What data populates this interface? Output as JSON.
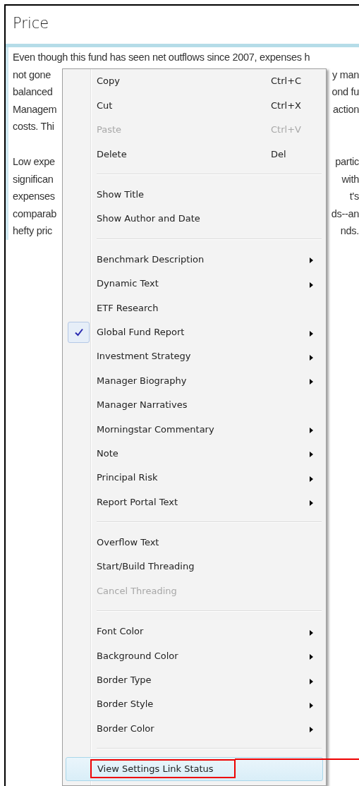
{
  "window": {
    "title": "Price"
  },
  "content": {
    "paragraphs": [
      {
        "lines": [
          {
            "left": "Even though this fund has seen net outflows since 2007, expenses h"
          },
          {
            "left": "not gone",
            "right": "y man"
          },
          {
            "left": "balanced",
            "right": "ond fu"
          },
          {
            "left": "Managem",
            "right": "action"
          },
          {
            "left": "costs. Thi"
          }
        ]
      },
      {
        "lines": [
          {
            "left": "Low expe",
            "right": "partic"
          },
          {
            "left": "significan",
            "right": "with"
          },
          {
            "left": "expenses",
            "right": "t's"
          },
          {
            "left": "comparab",
            "right": "ds--an"
          },
          {
            "left": "hefty pric",
            "right": "nds."
          }
        ]
      }
    ]
  },
  "context_menu": {
    "groups": [
      {
        "items": [
          {
            "label": "Copy",
            "shortcut": "Ctrl+C",
            "disabled": false,
            "checked": false,
            "submenu": false,
            "selected": false,
            "annotated": false
          },
          {
            "label": "Cut",
            "shortcut": "Ctrl+X",
            "disabled": false,
            "checked": false,
            "submenu": false,
            "selected": false,
            "annotated": false
          },
          {
            "label": "Paste",
            "shortcut": "Ctrl+V",
            "disabled": true,
            "checked": false,
            "submenu": false,
            "selected": false,
            "annotated": false
          },
          {
            "label": "Delete",
            "shortcut": "Del",
            "disabled": false,
            "checked": false,
            "submenu": false,
            "selected": false,
            "annotated": false
          }
        ]
      },
      {
        "items": [
          {
            "label": "Show Title",
            "disabled": false,
            "checked": false,
            "submenu": false,
            "selected": false,
            "annotated": false
          },
          {
            "label": "Show Author and Date",
            "disabled": false,
            "checked": false,
            "submenu": false,
            "selected": false,
            "annotated": false
          }
        ]
      },
      {
        "items": [
          {
            "label": "Benchmark Description",
            "disabled": false,
            "checked": false,
            "submenu": true,
            "selected": false,
            "annotated": false
          },
          {
            "label": "Dynamic Text",
            "disabled": false,
            "checked": false,
            "submenu": true,
            "selected": false,
            "annotated": false
          },
          {
            "label": "ETF Research",
            "disabled": false,
            "checked": false,
            "submenu": false,
            "selected": false,
            "annotated": false
          },
          {
            "label": "Global Fund Report",
            "disabled": false,
            "checked": true,
            "submenu": true,
            "selected": false,
            "annotated": false
          },
          {
            "label": "Investment Strategy",
            "disabled": false,
            "checked": false,
            "submenu": true,
            "selected": false,
            "annotated": false
          },
          {
            "label": "Manager Biography",
            "disabled": false,
            "checked": false,
            "submenu": true,
            "selected": false,
            "annotated": false
          },
          {
            "label": "Manager Narratives",
            "disabled": false,
            "checked": false,
            "submenu": false,
            "selected": false,
            "annotated": false
          },
          {
            "label": "Morningstar Commentary",
            "disabled": false,
            "checked": false,
            "submenu": true,
            "selected": false,
            "annotated": false
          },
          {
            "label": "Note",
            "disabled": false,
            "checked": false,
            "submenu": true,
            "selected": false,
            "annotated": false
          },
          {
            "label": "Principal Risk",
            "disabled": false,
            "checked": false,
            "submenu": true,
            "selected": false,
            "annotated": false
          },
          {
            "label": "Report Portal Text",
            "disabled": false,
            "checked": false,
            "submenu": true,
            "selected": false,
            "annotated": false
          }
        ]
      },
      {
        "items": [
          {
            "label": "Overflow Text",
            "disabled": false,
            "checked": false,
            "submenu": false,
            "selected": false,
            "annotated": false
          },
          {
            "label": "Start/Build Threading",
            "disabled": false,
            "checked": false,
            "submenu": false,
            "selected": false,
            "annotated": false
          },
          {
            "label": "Cancel Threading",
            "disabled": true,
            "checked": false,
            "submenu": false,
            "selected": false,
            "annotated": false
          }
        ]
      },
      {
        "items": [
          {
            "label": "Font Color",
            "disabled": false,
            "checked": false,
            "submenu": true,
            "selected": false,
            "annotated": false
          },
          {
            "label": "Background Color",
            "disabled": false,
            "checked": false,
            "submenu": true,
            "selected": false,
            "annotated": false
          },
          {
            "label": "Border Type",
            "disabled": false,
            "checked": false,
            "submenu": true,
            "selected": false,
            "annotated": false
          },
          {
            "label": "Border Style",
            "disabled": false,
            "checked": false,
            "submenu": true,
            "selected": false,
            "annotated": false
          },
          {
            "label": "Border Color",
            "disabled": false,
            "checked": false,
            "submenu": true,
            "selected": false,
            "annotated": false
          }
        ]
      },
      {
        "items": [
          {
            "label": "View Settings Link Status",
            "disabled": false,
            "checked": false,
            "submenu": false,
            "selected": true,
            "annotated": true
          }
        ]
      }
    ]
  }
}
